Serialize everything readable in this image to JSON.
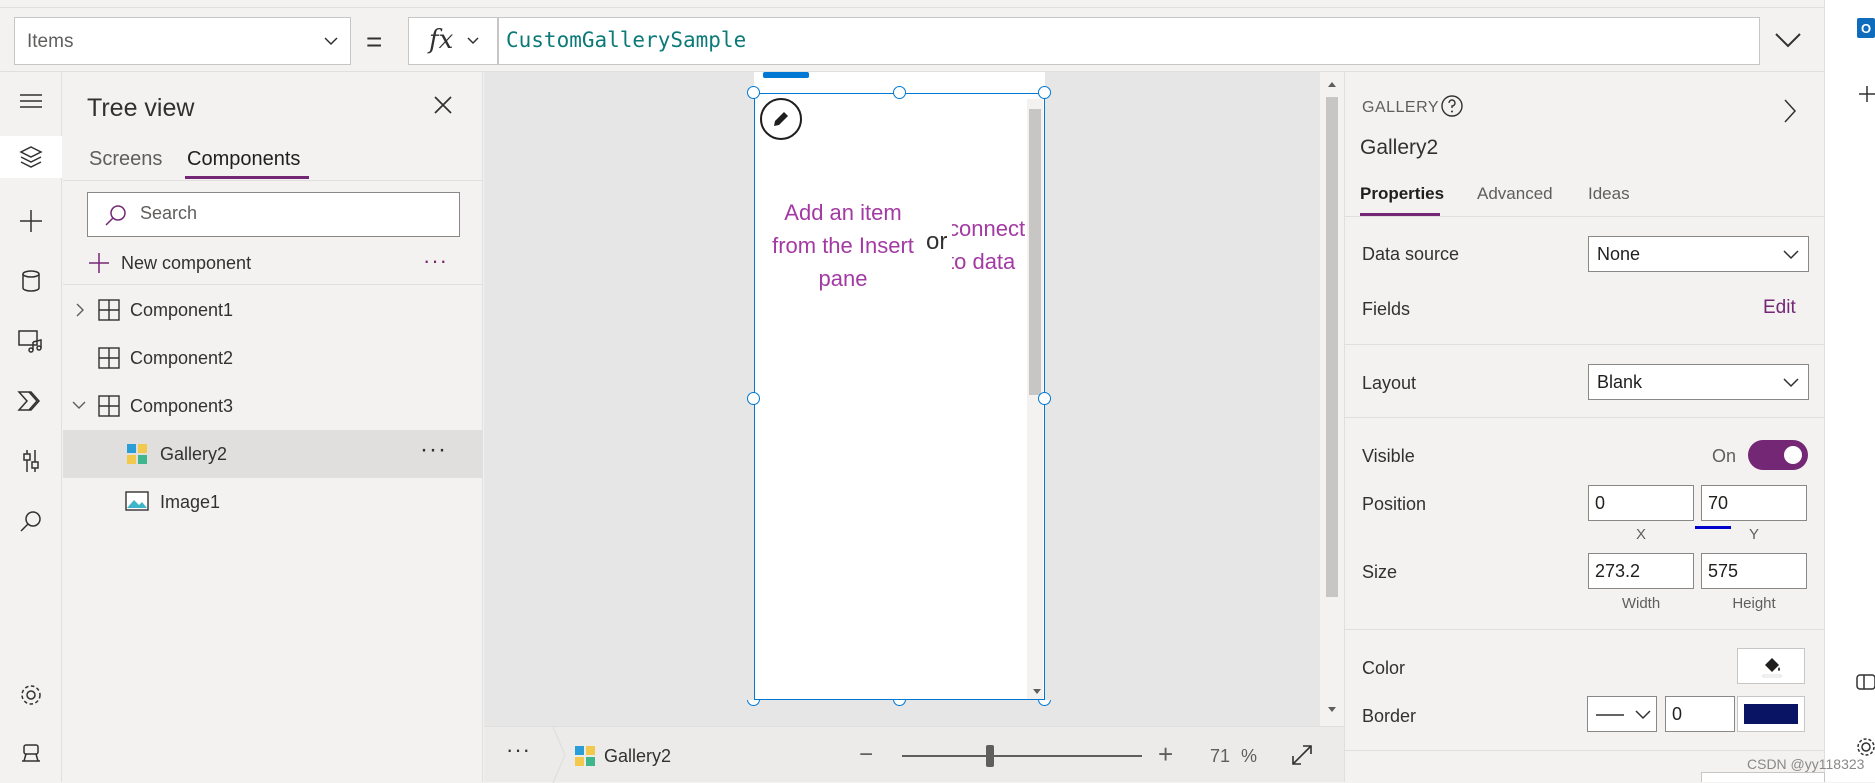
{
  "formula_bar": {
    "property": "Items",
    "equals": "=",
    "fx": "fx",
    "formula": "CustomGallerySample"
  },
  "left_rail": {
    "icons": [
      "hamburger-icon",
      "layers-icon",
      "insert-plus-icon",
      "data-icon",
      "media-icon",
      "power-automate-icon",
      "advanced-tools-icon",
      "search-icon",
      "settings-icon",
      "virtual-agent-icon"
    ]
  },
  "tree_view": {
    "title": "Tree view",
    "tabs": [
      "Screens",
      "Components"
    ],
    "active_tab": "Components",
    "search_placeholder": "Search",
    "new_component": "New component",
    "items": [
      {
        "label": "Component1",
        "type": "component",
        "expander": "collapsed"
      },
      {
        "label": "Component2",
        "type": "component",
        "expander": "none"
      },
      {
        "label": "Component3",
        "type": "component",
        "expander": "expanded"
      },
      {
        "label": "Gallery2",
        "type": "gallery",
        "selected": true
      },
      {
        "label": "Image1",
        "type": "image"
      }
    ]
  },
  "canvas": {
    "placeholder_left": "Add an item from the Insert pane",
    "placeholder_or": "or",
    "placeholder_right": "connect to data"
  },
  "status_bar": {
    "more": "···",
    "selected": "Gallery2",
    "zoom_minus": "−",
    "zoom_plus": "+",
    "zoom_value": "71",
    "zoom_unit": "%"
  },
  "properties": {
    "control_type": "GALLERY",
    "control_name": "Gallery2",
    "tabs": [
      "Properties",
      "Advanced",
      "Ideas"
    ],
    "active_tab": "Properties",
    "data_source_label": "Data source",
    "data_source_value": "None",
    "fields_label": "Fields",
    "fields_action": "Edit",
    "layout_label": "Layout",
    "layout_value": "Blank",
    "visible_label": "Visible",
    "visible_state": "On",
    "position_label": "Position",
    "position_x": "0",
    "position_y": "70",
    "x_label": "X",
    "y_label": "Y",
    "size_label": "Size",
    "width": "273.2",
    "height": "575",
    "width_label": "Width",
    "height_label": "Height",
    "color_label": "Color",
    "border_label": "Border",
    "border_width": "0",
    "border_color": "#0a1464"
  },
  "watermark": "CSDN @yy118323",
  "colors": {
    "accent": "#742774",
    "selection": "#0078d4",
    "placeholder": "#a33aa3"
  }
}
